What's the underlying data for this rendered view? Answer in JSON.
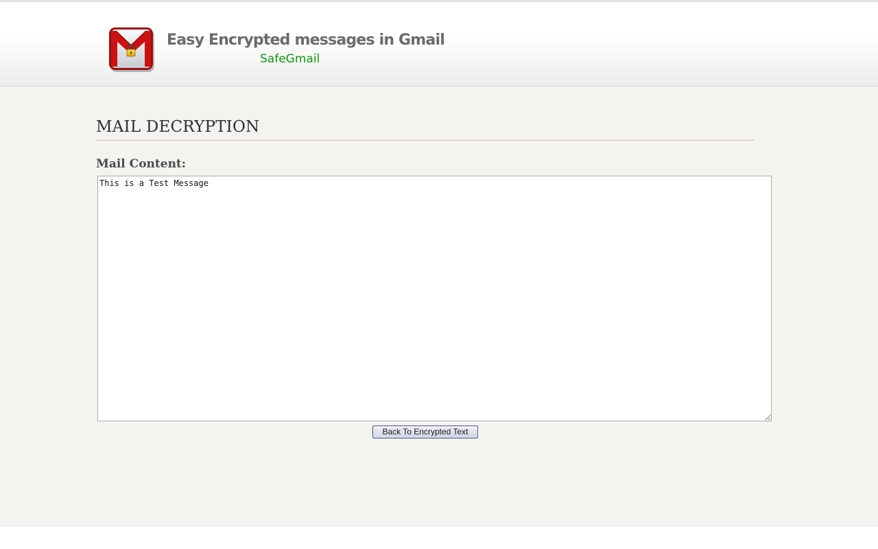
{
  "header": {
    "logo_icon": "gmail-lock-icon",
    "title": "Easy Encrypted messages in Gmail",
    "subtitle": "SafeGmail"
  },
  "main": {
    "section_title": "MAIL DECRYPTION",
    "mail_label": "Mail Content:",
    "mail_content": "This is a Test Message",
    "back_button_label": "Back To Encrypted Text"
  },
  "colors": {
    "subtitle": "#0d9a12",
    "title": "#6b6b6b",
    "content_background": "#f4f3ef"
  }
}
